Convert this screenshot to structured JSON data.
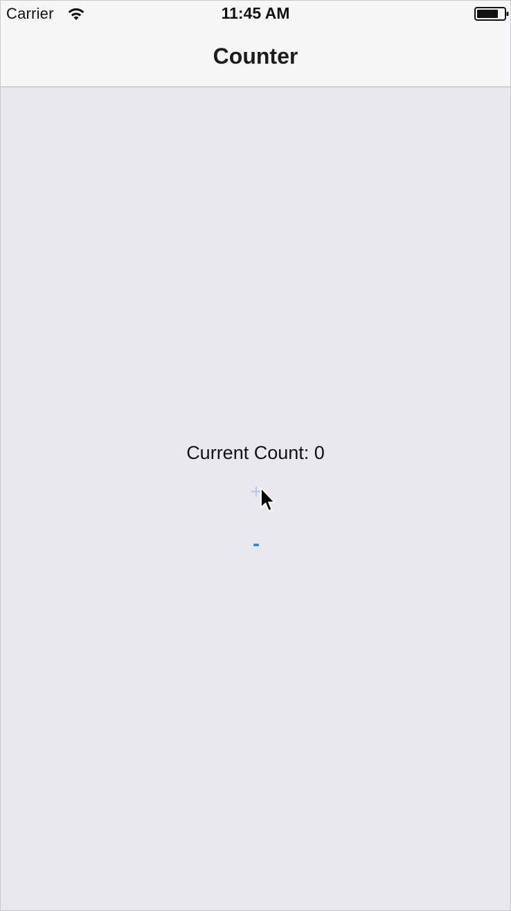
{
  "status_bar": {
    "carrier": "Carrier",
    "time": "11:45 AM",
    "icons": [
      "wifi-icon",
      "battery-icon"
    ]
  },
  "nav_bar": {
    "title": "Counter"
  },
  "content": {
    "count_label": "Current Count: 0",
    "increment_label": "+",
    "decrement_label": "-"
  },
  "colors": {
    "background": "#e9e8ee",
    "bar": "#f6f6f6",
    "button_tint": "#2b82e8",
    "button_highlight": "#b4cdee"
  }
}
